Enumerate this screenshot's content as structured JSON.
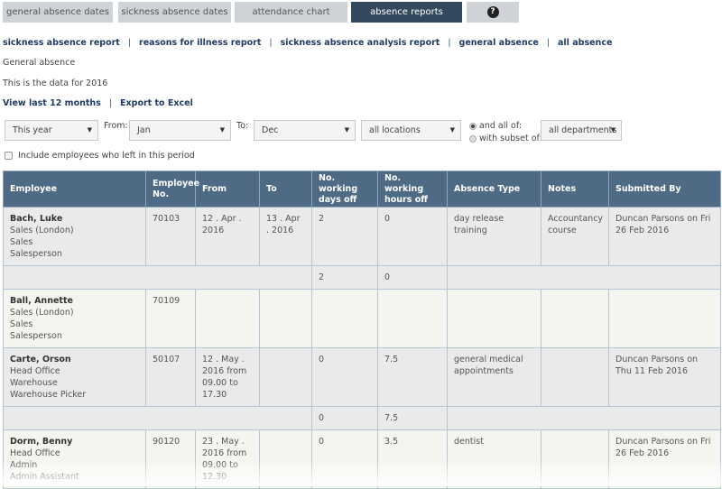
{
  "tabs": [
    {
      "label": "general absence dates",
      "active": false
    },
    {
      "label": "sickness absence dates",
      "active": false
    },
    {
      "label": "attendance chart",
      "active": false
    },
    {
      "label": "absence reports",
      "active": true
    },
    {
      "label": "?",
      "icon": "help-icon",
      "active": false
    }
  ],
  "sublinks": [
    "sickness absence report",
    "reasons for illness report",
    "sickness absence analysis report",
    "general absence",
    "all absence"
  ],
  "page_heading": "General absence",
  "data_note": "This is the data for 2016",
  "actions": {
    "view_last_12": "View last 12 months",
    "export": "Export to Excel"
  },
  "filters": {
    "period": {
      "value": "This year"
    },
    "from_label": "From:",
    "from": {
      "value": "Jan"
    },
    "to_label": "To:",
    "to": {
      "value": "Dec"
    },
    "location": {
      "value": "all locations"
    },
    "radio_all": {
      "label": "and all of:",
      "checked": true
    },
    "radio_subset": {
      "label": "with subset of:",
      "checked": false
    },
    "department": {
      "value": "all departments"
    },
    "include_left": {
      "label": "Include employees who left in this period",
      "checked": false
    }
  },
  "table": {
    "headers": [
      "Employee",
      "Employee No.",
      "From",
      "To",
      "No. working days off",
      "No. working hours off",
      "Absence Type",
      "Notes",
      "Submitted By"
    ],
    "rows": [
      {
        "name": "Bach, Luke",
        "location": "Sales (London)",
        "department": "Sales",
        "role": "Salesperson",
        "emp_no": "70103",
        "from": "12 . Apr . 2016",
        "to": "13 . Apr . 2016",
        "days": "2",
        "hours": "0",
        "type": "day release training",
        "notes": "Accountancy course",
        "submitted": "Duncan Parsons on Fri 26 Feb 2016",
        "total_days": "2",
        "total_hours": "0"
      },
      {
        "name": "Ball, Annette",
        "location": "Sales (London)",
        "department": "Sales",
        "role": "Salesperson",
        "emp_no": "70109",
        "from": "",
        "to": "",
        "days": "",
        "hours": "",
        "type": "",
        "notes": "",
        "submitted": ""
      },
      {
        "name": "Carte, Orson",
        "location": "Head Office",
        "department": "Warehouse",
        "role": "Warehouse Picker",
        "emp_no": "50107",
        "from": "12 . May . 2016 from 09.00 to 17.30",
        "to": "",
        "days": "0",
        "hours": "7.5",
        "type": "general medical appointments",
        "notes": "",
        "submitted": "Duncan Parsons on Thu 11 Feb 2016",
        "total_days": "0",
        "total_hours": "7.5"
      },
      {
        "name": "Dorm, Benny",
        "location": "Head Office",
        "department": "Admin",
        "role": "Admin Assistant",
        "emp_no": "90120",
        "from": "23 . May . 2016 from 09.00 to 12.30",
        "to": "",
        "days": "0",
        "hours": "3.5",
        "type": "dentist",
        "notes": "",
        "submitted": "Duncan Parsons on Fri 26 Feb 2016"
      }
    ]
  },
  "colors": {
    "accent": "#34495e",
    "header": "#4f6a84",
    "link": "#1f3b63",
    "tab": "#cfd2d7"
  }
}
